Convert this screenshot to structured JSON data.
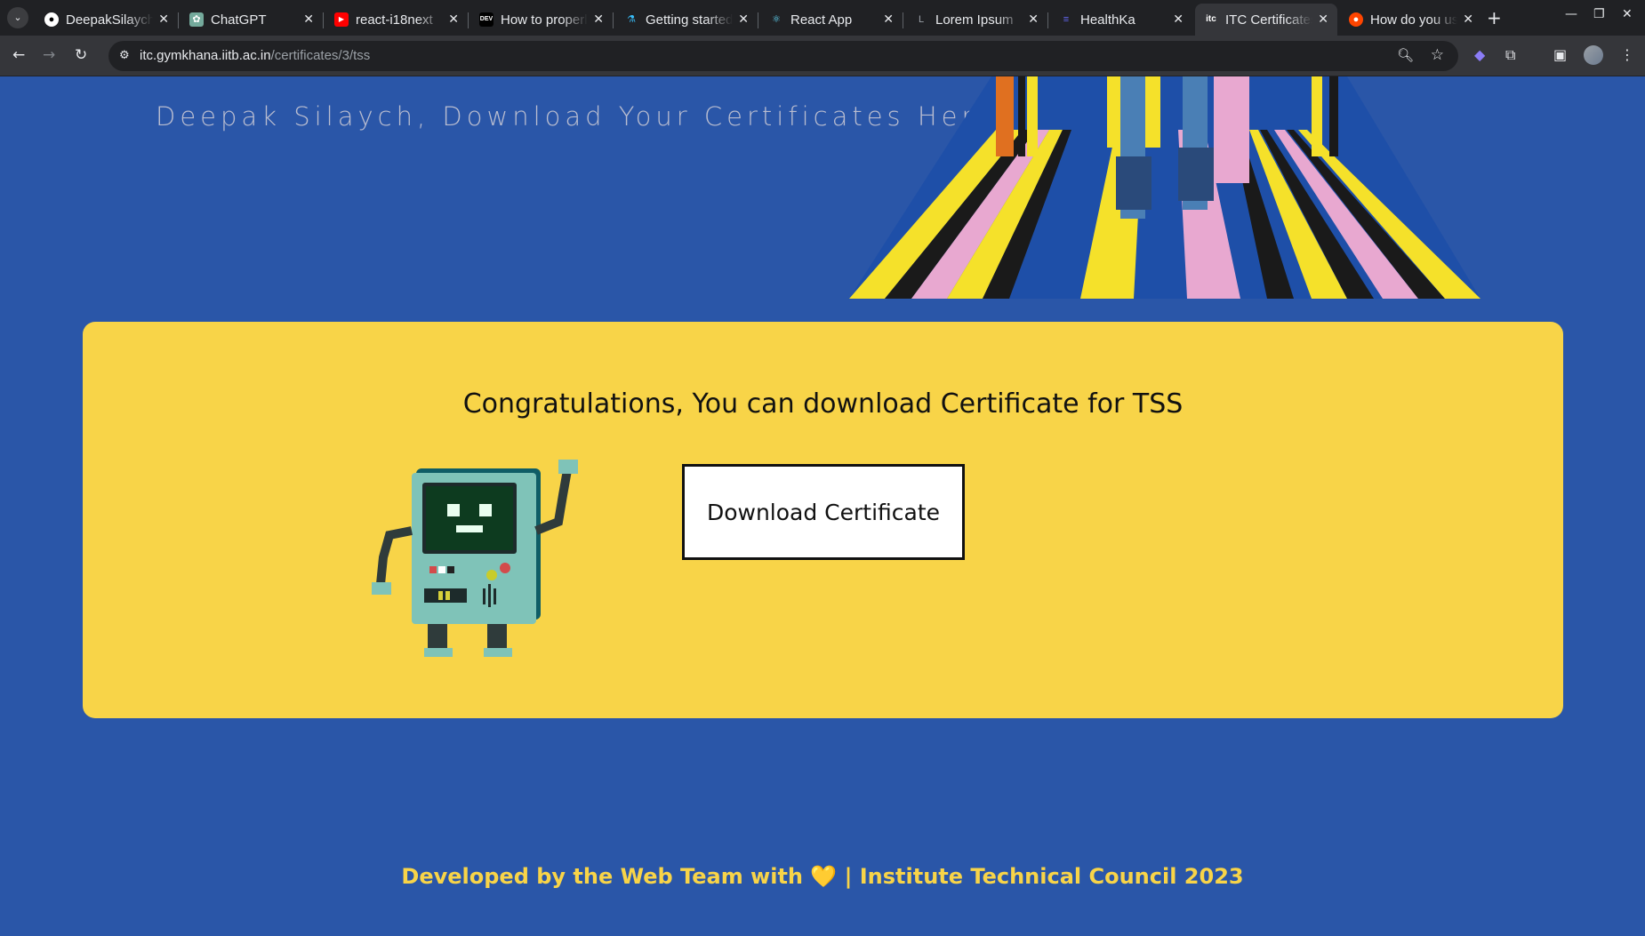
{
  "browser": {
    "tabs": [
      {
        "title": "DeepakSilaych",
        "icon": "github-icon",
        "color": "#ffffff"
      },
      {
        "title": "ChatGPT",
        "icon": "chatgpt-icon",
        "color": "#74aa9c"
      },
      {
        "title": "react-i18next",
        "icon": "youtube-icon",
        "color": "#ff0000"
      },
      {
        "title": "How to properly",
        "icon": "dev-icon",
        "color": "#000000"
      },
      {
        "title": "Getting started",
        "icon": "flask-icon",
        "color": "#38bdf8"
      },
      {
        "title": "React App",
        "icon": "react-icon",
        "color": "#61dafb"
      },
      {
        "title": "Lorem Ipsum",
        "icon": "lorem-icon",
        "color": "#444444"
      },
      {
        "title": "HealthKa",
        "icon": "healthka-icon",
        "color": "#4f46e5"
      },
      {
        "title": "ITC Certificates",
        "icon": "itc-icon",
        "color": "#ffffff"
      },
      {
        "title": "How do you use",
        "icon": "reddit-icon",
        "color": "#ff4500"
      }
    ],
    "active_tab_index": 8,
    "url_host": "itc.gymkhana.iitb.ac.in",
    "url_path": "/certificates/3/tss"
  },
  "page": {
    "hero_title": "Deepak Silaych, Download Your Certificates Here",
    "card_heading": "Congratulations, You can download Certificate for TSS",
    "download_label": "Download Certificate",
    "footer_text": "Developed by the Web Team with 💛 | Institute Technical Council 2023"
  },
  "colors": {
    "page_bg": "#2a56a8",
    "card_bg": "#f8d448",
    "footer_text": "#f8d448",
    "hero_title": "#b9bdd0"
  }
}
